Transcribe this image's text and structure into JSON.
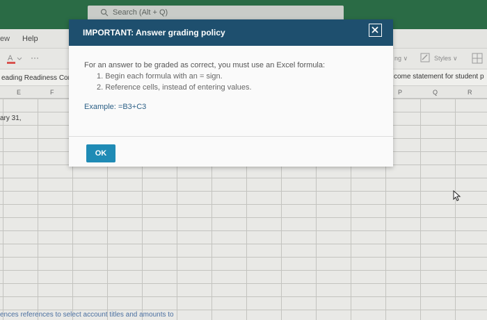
{
  "search": {
    "label": "Search (Alt + Q)"
  },
  "ribbon": {
    "tab_view": "ew",
    "tab_help": "Help",
    "more_label": "···",
    "right_label": "ng ∨",
    "styles_label": "Styles ∨"
  },
  "formula_bar": {
    "namebox": "eading Readiness Com",
    "formula": "come statement for student p"
  },
  "columns": [
    "E",
    "F",
    "P",
    "Q",
    "R"
  ],
  "cells": {
    "a31": "ary 31,",
    "bottom": "ences references to select account titles and amounts to"
  },
  "dialog": {
    "title": "IMPORTANT: Answer grading policy",
    "intro": "For an answer to be graded as correct, you must use an Excel formula:",
    "rules": [
      "1. Begin each formula with an = sign.",
      "2. Reference cells, instead of entering values."
    ],
    "example": "Example: =B3+C3",
    "ok_label": "OK"
  },
  "colors": {
    "titlebar": "#2a6b45",
    "dialog_header": "#1e4f6e",
    "ok_button": "#1f8bb5"
  }
}
